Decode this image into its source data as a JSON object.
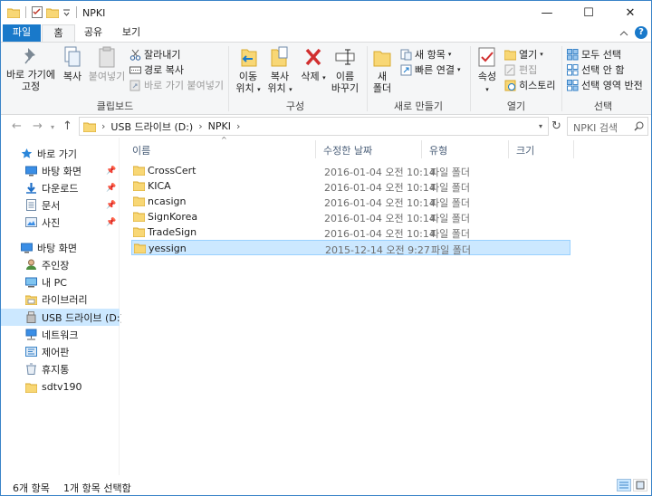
{
  "window": {
    "title": "NPKI",
    "controls": {
      "minimize": "—",
      "maximize": "☐",
      "close": "✕"
    }
  },
  "ribbon_tabs": [
    {
      "label": "파일"
    },
    {
      "label": "홈"
    },
    {
      "label": "공유"
    },
    {
      "label": "보기"
    }
  ],
  "ribbon": {
    "clipboard": {
      "pin_label_1": "바로 가기에",
      "pin_label_2": "고정",
      "copy": "복사",
      "paste": "붙여넣기",
      "cut": "잘라내기",
      "copy_path": "경로 복사",
      "paste_shortcut": "바로 가기 붙여넣기",
      "group": "클립보드"
    },
    "organize": {
      "move_1": "이동",
      "move_2": "위치",
      "copy_1": "복사",
      "copy_2": "위치",
      "delete": "삭제",
      "rename_1": "이름",
      "rename_2": "바꾸기",
      "group": "구성"
    },
    "new": {
      "new_folder_1": "새",
      "new_folder_2": "폴더",
      "new_item": "새 항목",
      "easy_access": "빠른 연결",
      "group": "새로 만들기"
    },
    "open": {
      "properties": "속성",
      "open": "열기",
      "edit": "편집",
      "history": "히스토리",
      "group": "열기"
    },
    "select": {
      "select_all": "모두 선택",
      "select_none": "선택 안 함",
      "invert": "선택 영역 반전",
      "group": "선택"
    }
  },
  "address": {
    "crumbs": [
      "USB 드라이브 (D:)",
      "NPKI"
    ],
    "search_placeholder": "NPKI 검색"
  },
  "nav": {
    "quick_access": "바로 가기",
    "quick_items": [
      {
        "label": "바탕 화면"
      },
      {
        "label": "다운로드"
      },
      {
        "label": "문서"
      },
      {
        "label": "사진"
      }
    ],
    "desktop": "바탕 화면",
    "tree": [
      {
        "label": "주인장"
      },
      {
        "label": "내 PC"
      },
      {
        "label": "라이브러리"
      },
      {
        "label": "USB 드라이브 (D:)"
      },
      {
        "label": "네트워크"
      },
      {
        "label": "제어판"
      },
      {
        "label": "휴지통"
      },
      {
        "label": "sdtv190"
      }
    ]
  },
  "columns": {
    "name": "이름",
    "modified": "수정한 날짜",
    "type": "유형",
    "size": "크기"
  },
  "files": [
    {
      "name": "CrossCert",
      "modified": "2016-01-04 오전 10:14",
      "type": "파일 폴더"
    },
    {
      "name": "KICA",
      "modified": "2016-01-04 오전 10:14",
      "type": "파일 폴더"
    },
    {
      "name": "ncasign",
      "modified": "2016-01-04 오전 10:14",
      "type": "파일 폴더"
    },
    {
      "name": "SignKorea",
      "modified": "2016-01-04 오전 10:14",
      "type": "파일 폴더"
    },
    {
      "name": "TradeSign",
      "modified": "2016-01-04 오전 10:14",
      "type": "파일 폴더"
    },
    {
      "name": "yessign",
      "modified": "2015-12-14 오전 9:27",
      "type": "파일 폴더"
    }
  ],
  "status": {
    "count": "6개 항목",
    "selected": "1개 항목 선택함"
  },
  "colors": {
    "accent": "#1979ca",
    "selection": "#cce8ff",
    "folder": "#f8d775"
  }
}
